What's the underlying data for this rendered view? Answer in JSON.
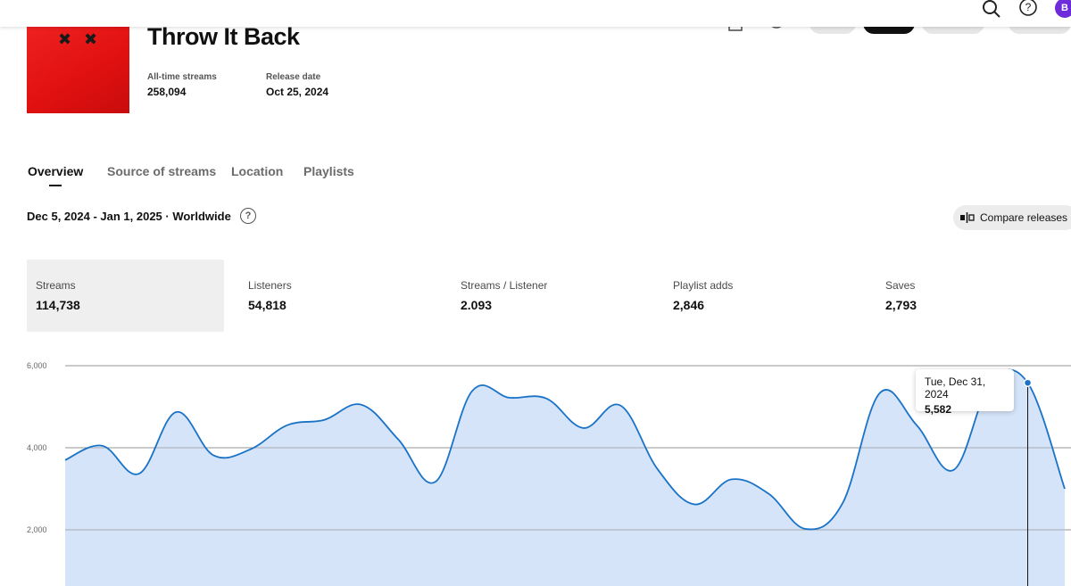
{
  "header": {
    "title": "Throw It Back",
    "all_time_streams_label": "All-time streams",
    "all_time_streams_value": "258,094",
    "release_date_label": "Release date",
    "release_date_value": "Oct 25, 2024",
    "avatar_initial": "B"
  },
  "tabs": [
    {
      "label": "Overview",
      "active": true
    },
    {
      "label": "Source of streams",
      "active": false
    },
    {
      "label": "Location",
      "active": false
    },
    {
      "label": "Playlists",
      "active": false
    }
  ],
  "filter": {
    "range_text": "Dec 5, 2024 - Jan 1, 2025 · Worldwide",
    "help_glyph": "?",
    "compare_label": "Compare releases"
  },
  "stats": [
    {
      "label": "Streams",
      "value": "114,738",
      "selected": true
    },
    {
      "label": "Listeners",
      "value": "54,818",
      "selected": false
    },
    {
      "label": "Streams / Listener",
      "value": "2.093",
      "selected": false
    },
    {
      "label": "Playlist adds",
      "value": "2,846",
      "selected": false
    },
    {
      "label": "Saves",
      "value": "2,793",
      "selected": false
    }
  ],
  "tooltip": {
    "date": "Tue, Dec 31, 2024",
    "value": "5,582"
  },
  "icons": {
    "search": "search-icon",
    "help": "help-icon",
    "compare": "compare-icon"
  },
  "colors": {
    "cover_red": "#e51414",
    "line": "#1a73c6",
    "area": "#d3e3f8",
    "accent_avatar": "#6e2bd9"
  },
  "chart_data": {
    "type": "area",
    "series": [
      {
        "values": [
          3700,
          4050,
          3370,
          4870,
          3820,
          3960,
          4550,
          4680,
          5050,
          4200,
          3170,
          5390,
          5220,
          5200,
          4480,
          5030,
          3480,
          2620,
          3230,
          2880,
          2020,
          2650,
          5330,
          4550,
          3460,
          5580,
          5582,
          3000
        ]
      }
    ],
    "y_ticks": [
      "6,000",
      "4,000",
      "2,000"
    ],
    "ylim": [
      0,
      6000
    ],
    "grid": true,
    "highlight_index": 26
  }
}
